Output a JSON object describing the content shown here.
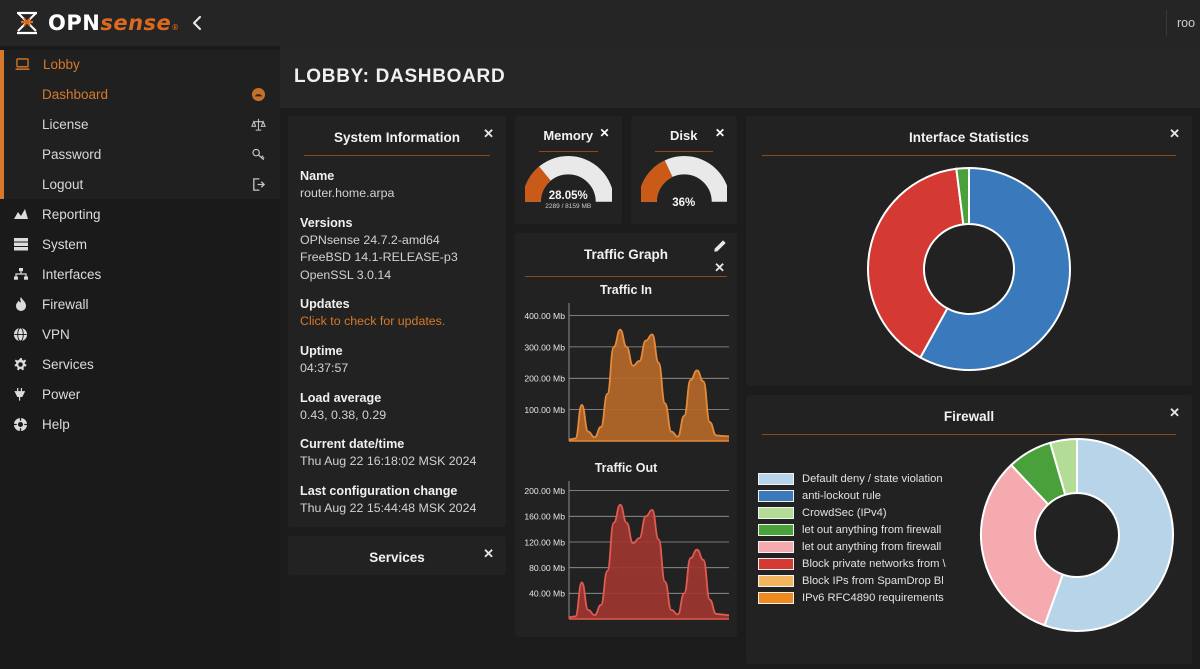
{
  "brand": {
    "name_opn": "OPN",
    "name_sense": "sense",
    "registered": "®"
  },
  "topbar": {
    "collapse_icon": "chevron-left-icon",
    "user": "roo"
  },
  "sidebar": {
    "group": {
      "label": "Lobby",
      "icon": "laptop-icon"
    },
    "sub_items": [
      {
        "label": "Dashboard",
        "icon": "dashboard-gauge-icon",
        "active": true
      },
      {
        "label": "License",
        "icon": "scales-icon",
        "active": false
      },
      {
        "label": "Password",
        "icon": "key-icon",
        "active": false
      },
      {
        "label": "Logout",
        "icon": "logout-icon",
        "active": false
      }
    ],
    "items": [
      {
        "label": "Reporting",
        "icon": "chart-area-icon"
      },
      {
        "label": "System",
        "icon": "server-icon"
      },
      {
        "label": "Interfaces",
        "icon": "sitemap-icon"
      },
      {
        "label": "Firewall",
        "icon": "fire-icon"
      },
      {
        "label": "VPN",
        "icon": "globe-icon"
      },
      {
        "label": "Services",
        "icon": "gear-icon"
      },
      {
        "label": "Power",
        "icon": "power-plug-icon"
      },
      {
        "label": "Help",
        "icon": "help-icon"
      }
    ]
  },
  "page": {
    "title": "LOBBY: DASHBOARD"
  },
  "system_information": {
    "title": "System Information",
    "close_icon": "close-icon",
    "rows": [
      {
        "label": "Name",
        "values": [
          "router.home.arpa"
        ]
      },
      {
        "label": "Versions",
        "values": [
          "OPNsense 24.7.2-amd64",
          "FreeBSD 14.1-RELEASE-p3",
          "OpenSSL 3.0.14"
        ]
      },
      {
        "label": "Updates",
        "values": [
          "Click to check for updates."
        ],
        "link": true
      },
      {
        "label": "Uptime",
        "values": [
          "04:37:57"
        ]
      },
      {
        "label": "Load average",
        "values": [
          "0.43, 0.38, 0.29"
        ]
      },
      {
        "label": "Current date/time",
        "values": [
          "Thu Aug 22 16:18:02 MSK 2024"
        ]
      },
      {
        "label": "Last configuration change",
        "values": [
          "Thu Aug 22 15:44:48 MSK 2024"
        ]
      }
    ]
  },
  "services_panel": {
    "title": "Services",
    "close_icon": "close-icon"
  },
  "memory_gauge": {
    "title": "Memory",
    "close_icon": "close-icon",
    "percent_label": "28.05%",
    "detail_label": "2289 / 8159 MB",
    "percent": 28.05,
    "arc_color": "#c95a18",
    "track_color": "#e9e9e9"
  },
  "disk_gauge": {
    "title": "Disk",
    "close_icon": "close-icon",
    "percent_label": "36%",
    "detail_label": "",
    "percent": 36,
    "arc_color": "#c95a18",
    "track_color": "#e9e9e9"
  },
  "traffic_graph": {
    "title": "Traffic Graph",
    "edit_icon": "pencil-icon",
    "close_icon": "close-icon"
  },
  "interface_statistics": {
    "title": "Interface Statistics",
    "close_icon": "close-icon"
  },
  "firewall_panel": {
    "title": "Firewall",
    "close_icon": "close-icon",
    "legend": [
      {
        "label": "Default deny / state violation",
        "color": "#b8d4e8"
      },
      {
        "label": "anti-lockout rule",
        "color": "#3b79bd"
      },
      {
        "label": "CrowdSec (IPv4)",
        "color": "#b3dd96"
      },
      {
        "label": "let out anything from firewall",
        "color": "#4aa03a"
      },
      {
        "label": "let out anything from firewall",
        "color": "#f5aab0"
      },
      {
        "label": "Block private networks from \\",
        "color": "#d43a33"
      },
      {
        "label": "Block IPs from SpamDrop Bl",
        "color": "#f2b45e"
      },
      {
        "label": "IPv6 RFC4890 requirements",
        "color": "#ef8a1f"
      }
    ]
  },
  "chart_data": [
    {
      "type": "area",
      "title": "Traffic In",
      "xlabel": "",
      "ylabel": "",
      "ylim": [
        0,
        440
      ],
      "yticks": [
        100,
        200,
        300,
        400
      ],
      "ytick_labels": [
        "100.00 Mb",
        "200.00 Mb",
        "300.00 Mb",
        "400.00 Mb"
      ],
      "grid": true,
      "line_color": "#e58a3a",
      "fill_color": "#b5692a",
      "x": [
        0,
        4,
        8,
        12,
        16,
        20,
        24,
        28,
        32,
        36,
        40,
        44,
        48,
        52,
        56,
        60,
        64,
        68,
        72,
        76,
        80,
        84,
        88,
        92,
        96,
        100
      ],
      "values": [
        5,
        8,
        115,
        30,
        12,
        45,
        150,
        300,
        355,
        300,
        240,
        255,
        320,
        340,
        250,
        120,
        30,
        14,
        80,
        195,
        225,
        190,
        60,
        18,
        16,
        15
      ]
    },
    {
      "type": "area",
      "title": "Traffic Out",
      "xlabel": "",
      "ylabel": "",
      "ylim": [
        0,
        215
      ],
      "yticks": [
        40,
        80,
        120,
        160,
        200
      ],
      "ytick_labels": [
        "40.00 Mb",
        "80.00 Mb",
        "120.00 Mb",
        "160.00 Mb",
        "200.00 Mb"
      ],
      "grid": true,
      "line_color": "#e05a52",
      "fill_color": "#9e3631",
      "x": [
        0,
        4,
        8,
        12,
        16,
        20,
        24,
        28,
        32,
        36,
        40,
        44,
        48,
        52,
        56,
        60,
        64,
        68,
        72,
        76,
        80,
        84,
        88,
        92,
        96,
        100
      ],
      "values": [
        3,
        4,
        57,
        14,
        6,
        22,
        75,
        150,
        178,
        150,
        118,
        126,
        160,
        170,
        124,
        58,
        14,
        7,
        40,
        95,
        108,
        92,
        30,
        8,
        7,
        6
      ]
    },
    {
      "type": "pie",
      "title": "Interface Statistics",
      "labels": [
        "segment-blue",
        "segment-red",
        "segment-green"
      ],
      "values": [
        58,
        40,
        2
      ],
      "colors": [
        "#3b79bd",
        "#d43a33",
        "#4aa03a"
      ],
      "donut": true,
      "legend": "none"
    },
    {
      "type": "pie",
      "title": "Firewall",
      "labels": [
        "Default deny / state violation",
        "let out anything from firewall",
        "let out anything from firewall",
        "CrowdSec (IPv4)"
      ],
      "values": [
        55.5,
        32.5,
        7.5,
        4.5
      ],
      "colors": [
        "#b8d4e8",
        "#f5aab0",
        "#4aa03a",
        "#b3dd96"
      ],
      "donut": true,
      "legend": "left"
    }
  ]
}
